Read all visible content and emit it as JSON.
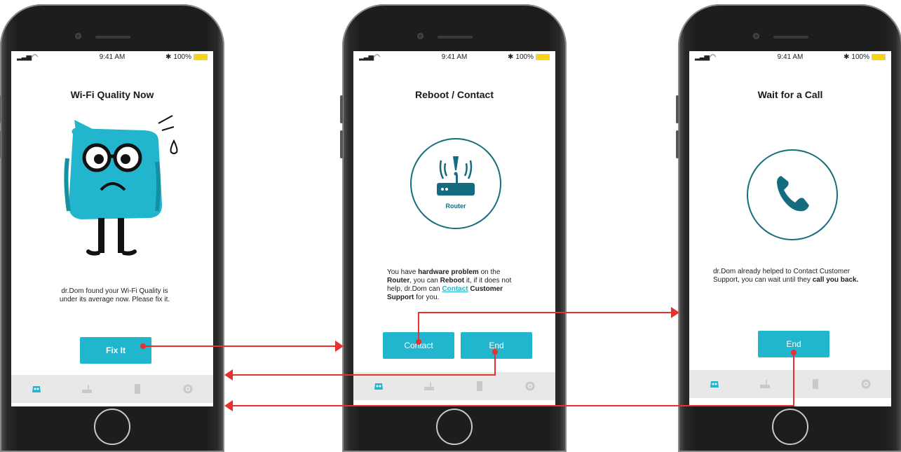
{
  "status": {
    "time": "9:41 AM",
    "battery": "100%",
    "signal": "▐▐▐"
  },
  "screens": [
    {
      "title": "Wi-Fi Quality Now",
      "message": "dr.Dom found your Wi-Fi Quality is under its average now. Please fix it.",
      "button": "Fix It"
    },
    {
      "title": "Reboot / Contact",
      "icon_label": "Router",
      "msg_parts": {
        "a": "You have ",
        "b": "hardware problem",
        "c": " on the ",
        "d": "Router",
        "e": ", you can ",
        "f": "Reboot",
        "g": " it, if it does not help, dr.Dom can ",
        "h": "Contact",
        "i": " Customer Support",
        "j": " for you."
      },
      "buttons": {
        "contact": "Contact",
        "end": "End"
      }
    },
    {
      "title": "Wait for a Call",
      "msg_parts": {
        "a": "dr.Dom already helped to Contact Customer Support, you can wait until they ",
        "b": "call you back."
      },
      "button": "End"
    }
  ],
  "colors": {
    "accent": "#21b6cd",
    "teal_dark": "#146c7e",
    "arrow": "#e8302f",
    "tabbar": "#e8e8e8"
  },
  "icons": [
    "mascot-icon",
    "router-icon",
    "device-icon",
    "settings-icon",
    "phone-icon"
  ]
}
